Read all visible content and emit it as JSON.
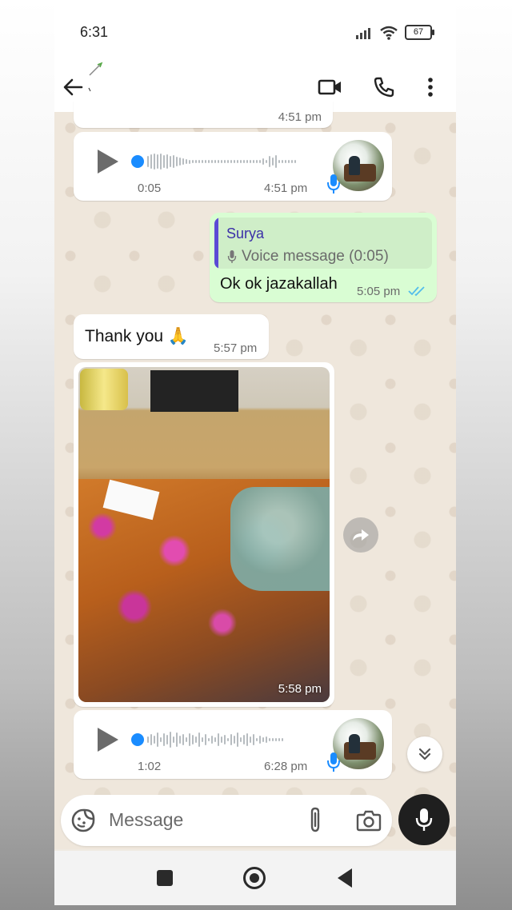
{
  "status_bar": {
    "time": "6:31",
    "battery": "67"
  },
  "header": {
    "contact_name": ""
  },
  "messages": {
    "prev_time": "4:51 pm",
    "voice1": {
      "duration": "0:05",
      "time": "4:51 pm"
    },
    "reply": {
      "quoted_author": "Surya",
      "quoted_text": "Voice message (0:05)",
      "text": "Ok ok jazakallah",
      "time": "5:05 pm"
    },
    "thanks": {
      "text": "Thank you 🙏",
      "time": "5:57 pm"
    },
    "photo": {
      "time": "5:58 pm"
    },
    "voice2": {
      "duration": "1:02",
      "time": "6:28 pm"
    }
  },
  "composer": {
    "placeholder": "Message"
  },
  "icons": {
    "back": "back-arrow-icon",
    "video": "video-call-icon",
    "call": "phone-icon",
    "menu": "more-vert-icon",
    "emoji": "sticker-icon",
    "attach": "attach-icon",
    "camera": "camera-icon",
    "mic": "mic-icon",
    "forward": "forward-icon",
    "scroll": "double-chevron-down-icon"
  },
  "colors": {
    "outgoing": "#d9fdd3",
    "incoming": "#ffffff",
    "tick_read": "#53bdeb",
    "quote_bar": "#5b4bd5",
    "play_dot": "#1a8cff"
  }
}
